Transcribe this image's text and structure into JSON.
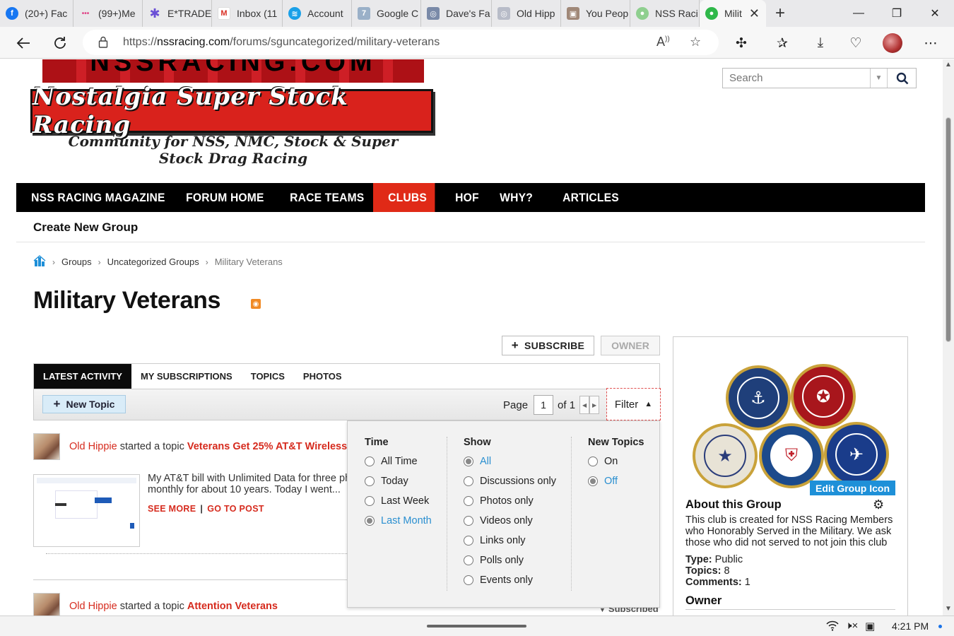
{
  "browser": {
    "tabs": [
      {
        "label": "(20+) Fac",
        "color": "#1877f2",
        "glyph": "f"
      },
      {
        "label": "(99+)Me",
        "color": "#e04a8a",
        "glyph": "•••"
      },
      {
        "label": "E*TRADE",
        "color": "#6a4fd6",
        "glyph": "✱"
      },
      {
        "label": "Inbox (11",
        "color": "#ffffff",
        "glyph": "M"
      },
      {
        "label": "Account",
        "color": "#1aa0e8",
        "glyph": "≋"
      },
      {
        "label": "Google C",
        "color": "#9ab0c8",
        "glyph": "7"
      },
      {
        "label": "Dave's Fa",
        "color": "#7a8aa8",
        "glyph": "◎"
      },
      {
        "label": "Old Hipp",
        "color": "#b8bcc8",
        "glyph": "◎"
      },
      {
        "label": "You Peop",
        "color": "#a08878",
        "glyph": "▣"
      },
      {
        "label": "NSS Raci",
        "color": "#8fcf8f",
        "glyph": "●"
      },
      {
        "label": "Milit",
        "color": "#2fb84a",
        "glyph": "●"
      }
    ],
    "close_tab_glyph": "✕",
    "new_tab_glyph": "+",
    "window_controls": [
      "—",
      "❐",
      "✕"
    ],
    "url_scheme": "https://",
    "url_host": "nssracing.com",
    "url_path": "/forums/sguncategorized/military-veterans"
  },
  "site": {
    "logo_top_text": "NSSRACING.COM",
    "logo_title": "Nostalgia Super Stock Racing",
    "logo_subtitle": "Community for NSS, NMC, Stock & Super Stock Drag Racing",
    "search_placeholder": "Search",
    "nav": [
      {
        "label": "NSS RACING MAGAZINE",
        "active": false
      },
      {
        "label": "FORUM HOME",
        "active": false
      },
      {
        "label": "RACE TEAMS",
        "active": false
      },
      {
        "label": "CLUBS",
        "active": true
      },
      {
        "label": "HOF",
        "active": false
      },
      {
        "label": "WHY?",
        "active": false
      },
      {
        "label": "ARTICLES",
        "active": false
      }
    ],
    "subnav_create": "Create New Group"
  },
  "breadcrumb": {
    "items": [
      "Groups",
      "Uncategorized Groups"
    ],
    "current": "Military Veterans"
  },
  "group": {
    "title": "Military Veterans",
    "subscribe_label": "SUBSCRIBE",
    "owner_label": "OWNER"
  },
  "tabs": [
    {
      "label": "LATEST ACTIVITY",
      "active": true
    },
    {
      "label": "MY SUBSCRIPTIONS",
      "active": false
    },
    {
      "label": "TOPICS",
      "active": false
    },
    {
      "label": "PHOTOS",
      "active": false
    }
  ],
  "toolbar": {
    "new_topic_label": "New Topic",
    "page_label": "Page",
    "page_value": "1",
    "of_label": "of 1",
    "filter_label": "Filter"
  },
  "feed": [
    {
      "user": "Old Hippie",
      "action": "started a topic",
      "topic": "Veterans Get 25% AT&T Wireless M",
      "excerpt_line1": "My AT&T bill with Unlimited Data for three pho",
      "excerpt_line2": "monthly for about 10 years. Today I went...",
      "see_more": "SEE MORE",
      "go_to_post": "GO TO POST"
    },
    {
      "user": "Old Hippie",
      "action": "started a topic",
      "topic": "Attention Veterans"
    }
  ],
  "subscribed_label": "Subscribed",
  "filter": {
    "time": {
      "heading": "Time",
      "options": [
        "All Time",
        "Today",
        "Last Week",
        "Last Month"
      ],
      "selected": "Last Month"
    },
    "show": {
      "heading": "Show",
      "options": [
        "All",
        "Discussions only",
        "Photos only",
        "Videos only",
        "Links only",
        "Polls only",
        "Events only"
      ],
      "selected": "All"
    },
    "new_topics": {
      "heading": "New Topics",
      "options": [
        "On",
        "Off"
      ],
      "selected": "Off"
    }
  },
  "sidebar": {
    "edit_icon_label": "Edit Group Icon",
    "about_heading": "About this Group",
    "about_text": "This club is created for NSS Racing Members who Honorably Served in the Military. We ask those who did not served to not join this club",
    "type_label": "Type:",
    "type_value": "Public",
    "topics_label": "Topics:",
    "topics_value": "8",
    "comments_label": "Comments:",
    "comments_value": "1",
    "owner_heading": "Owner",
    "seals": [
      {
        "name": "navy-seal",
        "bg": "#1f3f7a",
        "glyph": "⚓"
      },
      {
        "name": "marine-corps-seal",
        "bg": "#a8161c",
        "glyph": "✪"
      },
      {
        "name": "army-seal",
        "bg": "#e8e3d6",
        "glyph": "★"
      },
      {
        "name": "coast-guard-seal",
        "bg": "#1c4a8c",
        "glyph": "⛨"
      },
      {
        "name": "air-force-seal",
        "bg": "#1a3c8a",
        "glyph": "✈"
      }
    ]
  },
  "taskbar": {
    "time": "4:21 PM"
  }
}
